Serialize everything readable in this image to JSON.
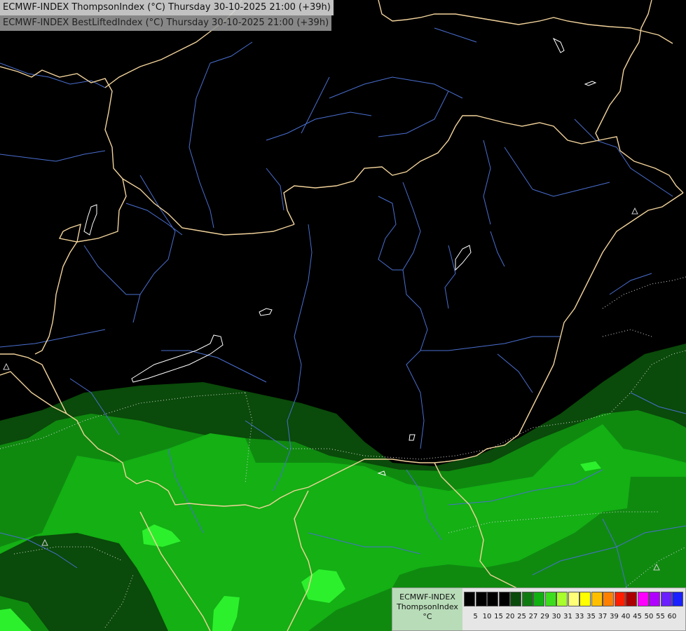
{
  "header": {
    "line1": "ECMWF-INDEX ThompsonIndex (°C) Thursday 30-10-2025 21:00 (+39h)",
    "line2": "ECMWF-INDEX BestLiftedIndex (°C) Thursday 30-10-2025 21:00 (+39h)"
  },
  "legend": {
    "model": "ECMWF-INDEX",
    "parameter": "ThompsonIndex",
    "unit": "°C",
    "ticks": [
      "5",
      "10",
      "15",
      "20",
      "25",
      "27",
      "29",
      "30",
      "31",
      "33",
      "35",
      "37",
      "39",
      "40",
      "45",
      "50",
      "55",
      "60"
    ],
    "colors": [
      "#000000",
      "#000000",
      "#000000",
      "#000000",
      "#0a4a0a",
      "#0f7a0f",
      "#11b011",
      "#3cdd1c",
      "#a8ff2c",
      "#ffff77",
      "#ffff00",
      "#ffbf00",
      "#ff7f00",
      "#ff1f00",
      "#aa0000",
      "#ff00ff",
      "#b000ff",
      "#6a20ff",
      "#1a20ff"
    ]
  },
  "colors": {
    "border": "#f2d39b",
    "river": "#4a6fd0",
    "lake_outline": "#ffffff",
    "field_dark": "#0a4a0a",
    "field_mid": "#0f8a0f",
    "field_light": "#14b014",
    "field_bright": "#2cf02c"
  }
}
